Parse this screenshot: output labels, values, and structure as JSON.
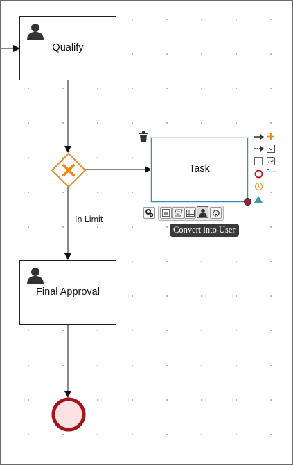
{
  "canvas": {
    "tasks": {
      "qualify": {
        "label": "Qualify"
      },
      "task": {
        "label": "Task"
      },
      "final_approval": {
        "label": "Final Approval"
      }
    },
    "flows": {
      "in_limit": {
        "label": "In Limit"
      }
    }
  },
  "toolbar": {
    "tooltip": "Convert into User"
  },
  "colors": {
    "gateway_stroke": "#ee8a2b",
    "end_event_stroke": "#a4161c",
    "end_event_fill": "#fbe3e3",
    "selection": "#2f8fb8",
    "palette_orange": "#f08a24",
    "palette_teal": "#3b9aa8"
  },
  "icons": [
    "user-icon",
    "trash-icon",
    "gear-icon",
    "arrow-icon",
    "plus-icon",
    "dotted-arrow-icon",
    "square-icon",
    "circle-icon",
    "clock-icon",
    "triangle-icon",
    "table-icon"
  ]
}
